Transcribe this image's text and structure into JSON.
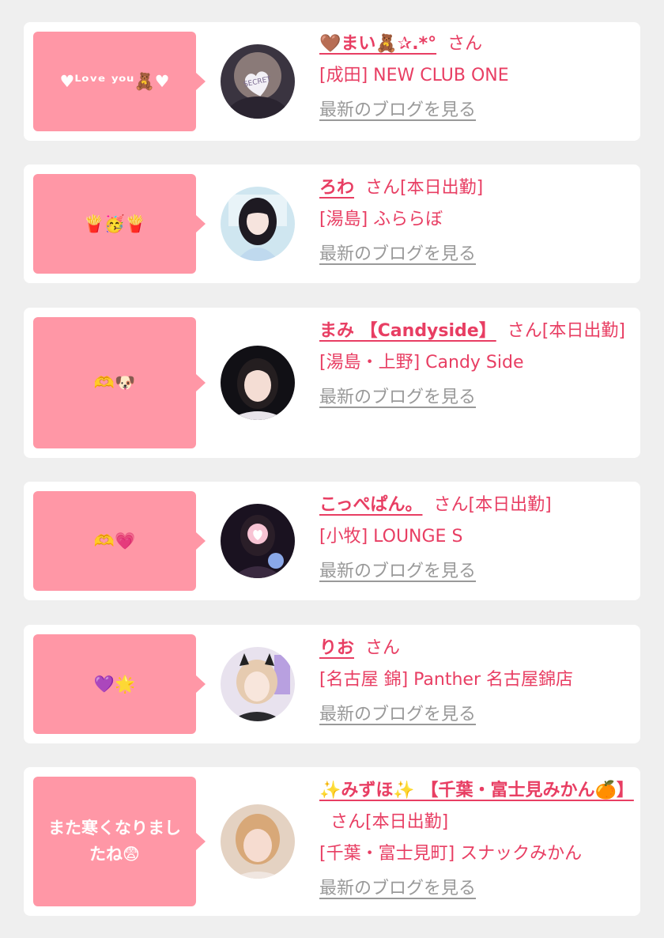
{
  "cards": [
    {
      "message": "♥ᴸᵒᵛᵉ ʸᵒᵘ🧸♥",
      "name": "🤎まい🧸✰.*°",
      "san": "さん",
      "status": "",
      "shop": "[成田] NEW CLUB ONE",
      "blog_link": "最新のブログを見る",
      "avatar": "SECRET"
    },
    {
      "message": "🍟🥳🍟",
      "name": "ろわ",
      "san": "さん",
      "status": "[本日出勤]",
      "shop": "[湯島] ふららぼ",
      "blog_link": "最新のブログを見る"
    },
    {
      "message": "🫶🐶",
      "name": "まみ 【Candyside】",
      "san": "さん",
      "status": "[本日出勤]",
      "shop": "[湯島・上野] Candy Side",
      "blog_link": "最新のブログを見る"
    },
    {
      "message": "🫶💗",
      "name": "こっぺぱん。",
      "san": "さん",
      "status": "[本日出勤]",
      "shop": "[小牧] LOUNGE S",
      "blog_link": "最新のブログを見る"
    },
    {
      "message": "💜🌟",
      "name": "りお",
      "san": "さん",
      "status": "",
      "shop": "[名古屋 錦] Panther 名古屋錦店",
      "blog_link": "最新のブログを見る"
    },
    {
      "message": "また寒くなりましたね😨",
      "name": "✨みずほ✨ 【千葉・富士見みかん🍊】",
      "san": "さん",
      "status": "[本日出勤]",
      "shop": "[千葉・富士見町] スナックみかん",
      "blog_link": "最新のブログを見る"
    }
  ],
  "colors": {
    "accent": "#e83e63",
    "bubble": "#ff97a6",
    "link_gray": "#999999",
    "background": "#efefef"
  }
}
